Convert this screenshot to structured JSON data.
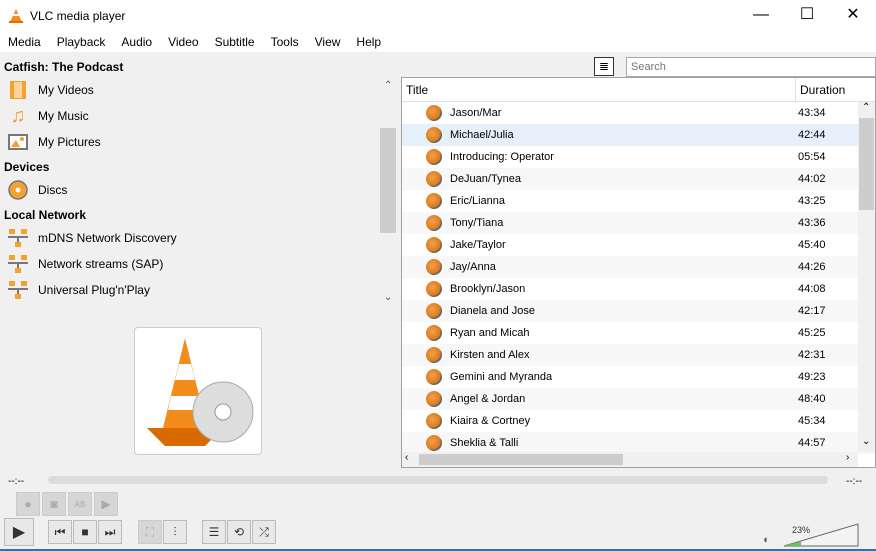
{
  "window": {
    "title": "VLC media player",
    "minimize": "—",
    "maximize": "☐",
    "close": "✕"
  },
  "menu": [
    "Media",
    "Playback",
    "Audio",
    "Video",
    "Subtitle",
    "Tools",
    "View",
    "Help"
  ],
  "sidebar": {
    "sections": [
      {
        "title": "Catfish: The Podcast",
        "items": [
          {
            "label": "My Videos",
            "icon": "film-icon"
          },
          {
            "label": "My Music",
            "icon": "music-note-icon"
          },
          {
            "label": "My Pictures",
            "icon": "picture-icon"
          }
        ]
      },
      {
        "title": "Devices",
        "items": [
          {
            "label": "Discs",
            "icon": "disc-icon"
          }
        ]
      },
      {
        "title": "Local Network",
        "items": [
          {
            "label": "mDNS Network Discovery",
            "icon": "network-icon"
          },
          {
            "label": "Network streams (SAP)",
            "icon": "network-icon"
          },
          {
            "label": "Universal Plug'n'Play",
            "icon": "network-icon"
          }
        ]
      }
    ]
  },
  "search": {
    "placeholder": "Search"
  },
  "playlist": {
    "columns": [
      "Title",
      "Duration"
    ],
    "rows": [
      [
        "Jason/Mar",
        "43:34"
      ],
      [
        "Michael/Julia",
        "42:44"
      ],
      [
        "Introducing: Operator",
        "05:54"
      ],
      [
        "DeJuan/Tynea",
        "44:02"
      ],
      [
        "Eric/Lianna",
        "43:25"
      ],
      [
        "Tony/Tiana",
        "43:36"
      ],
      [
        "Jake/Taylor",
        "45:40"
      ],
      [
        "Jay/Anna",
        "44:26"
      ],
      [
        "Brooklyn/Jason",
        "44:08"
      ],
      [
        "Dianela and Jose",
        "42:17"
      ],
      [
        "Ryan and Micah",
        "45:25"
      ],
      [
        "Kirsten and Alex",
        "42:31"
      ],
      [
        "Gemini and Myranda",
        "49:23"
      ],
      [
        "Angel & Jordan",
        "48:40"
      ],
      [
        "Kiaira & Cortney",
        "45:34"
      ],
      [
        "Sheklia & Talli",
        "44:57"
      ]
    ],
    "selected_index": 1
  },
  "player": {
    "elapsed": "--:--",
    "remaining": "--:--",
    "seek_progress": 0,
    "volume": "23%",
    "volume_level": 0.23
  }
}
